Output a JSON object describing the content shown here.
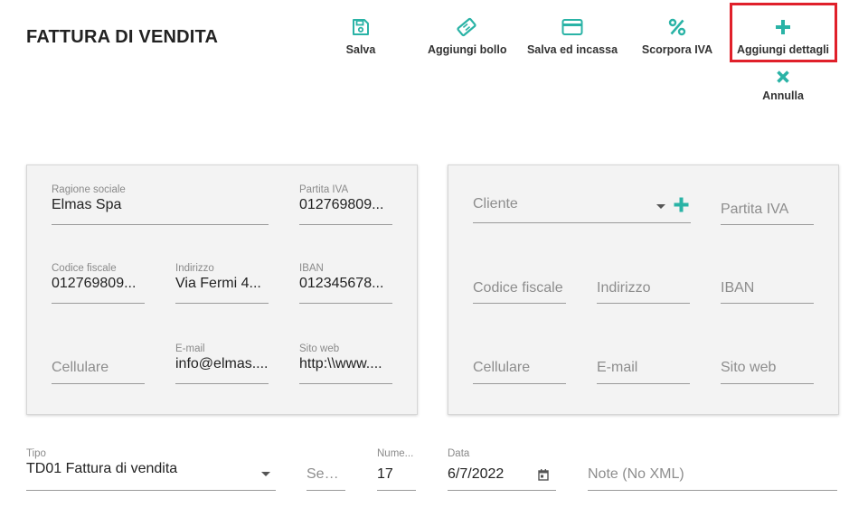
{
  "page": {
    "title": "FATTURA DI VENDITA"
  },
  "toolbar": {
    "salva": "Salva",
    "aggiungi_bollo": "Aggiungi bollo",
    "salva_incassa": "Salva ed incassa",
    "scorpora_iva": "Scorpora IVA",
    "aggiungi_dettagli": "Aggiungi dettagli",
    "annulla": "Annulla"
  },
  "colors": {
    "accent": "#2ab3a6",
    "highlight": "#e0202a"
  },
  "seller": {
    "ragione_sociale": {
      "label": "Ragione sociale",
      "value": "Elmas Spa"
    },
    "partita_iva": {
      "label": "Partita IVA",
      "value": "012769809..."
    },
    "codice_fiscale": {
      "label": "Codice fiscale",
      "value": "012769809..."
    },
    "indirizzo": {
      "label": "Indirizzo",
      "value": "Via Fermi 4..."
    },
    "iban": {
      "label": "IBAN",
      "value": "012345678..."
    },
    "cellulare": {
      "placeholder": "Cellulare"
    },
    "email": {
      "label": "E-mail",
      "value": "info@elmas...."
    },
    "sito_web": {
      "label": "Sito web",
      "value": "http:\\\\www...."
    }
  },
  "customer": {
    "cliente": {
      "placeholder": "Cliente"
    },
    "partita_iva": {
      "placeholder": "Partita IVA"
    },
    "codice_fiscale": {
      "placeholder": "Codice fiscale"
    },
    "indirizzo": {
      "placeholder": "Indirizzo"
    },
    "iban": {
      "placeholder": "IBAN"
    },
    "cellulare": {
      "placeholder": "Cellulare"
    },
    "email": {
      "placeholder": "E-mail"
    },
    "sito_web": {
      "placeholder": "Sito web"
    }
  },
  "document": {
    "tipo": {
      "label": "Tipo",
      "value": "TD01 Fattura di vendita"
    },
    "sezionale": {
      "placeholder": "Sezi..."
    },
    "numero": {
      "label": "Nume...",
      "value": "17"
    },
    "data": {
      "label": "Data",
      "value": "6/7/2022"
    },
    "note": {
      "placeholder": "Note (No XML)"
    }
  }
}
